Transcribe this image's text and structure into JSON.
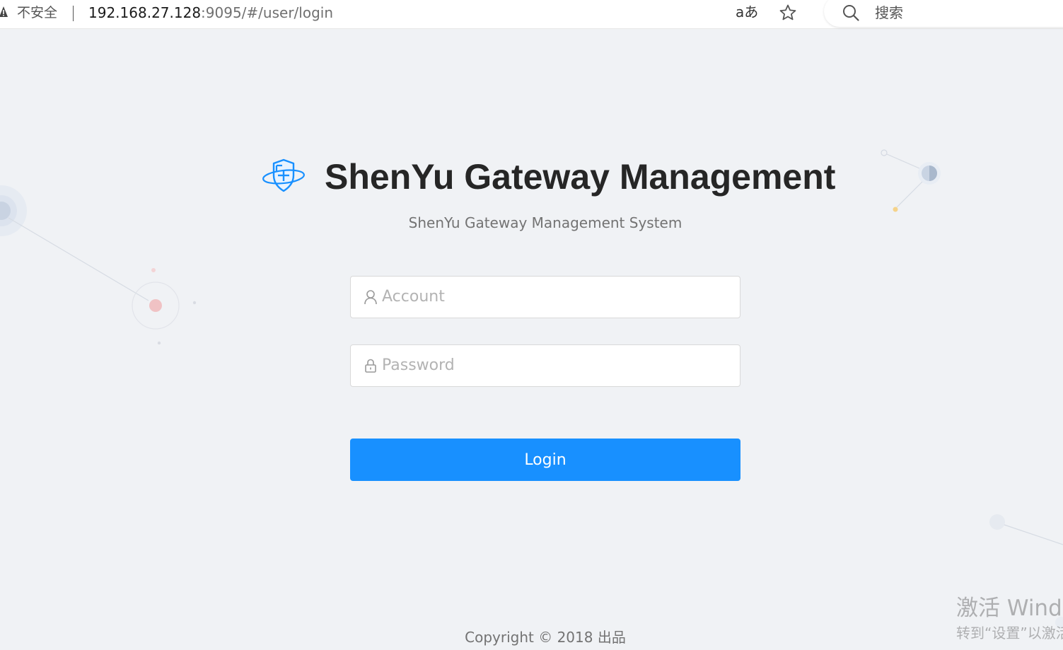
{
  "browser": {
    "security_label": "不安全",
    "url_host": "192.168.27.128",
    "url_rest": ":9095/#/user/login",
    "read_aloud_label": "aあ",
    "search_label": "搜索",
    "icons": [
      "warning-icon",
      "read-aloud-icon",
      "favorite-star-icon",
      "search-icon"
    ]
  },
  "login": {
    "title": "ShenYu Gateway Management",
    "subtitle": "ShenYu Gateway Management System",
    "account_placeholder": "Account",
    "password_placeholder": "Password",
    "account_value": "",
    "password_value": "",
    "button_label": "Login",
    "icons": [
      "shield-logo-icon",
      "user-icon",
      "lock-icon"
    ]
  },
  "footer": {
    "copyright": "Copyright © 2018 出品"
  },
  "watermark": {
    "line1": "激活 Windo",
    "line2": "转到“设置”以激活"
  },
  "colors": {
    "page_background": "#f0f2f5",
    "primary": "#1890ff",
    "title_text": "#262626",
    "muted_text": "#737373",
    "input_border": "#d9d9d9"
  }
}
